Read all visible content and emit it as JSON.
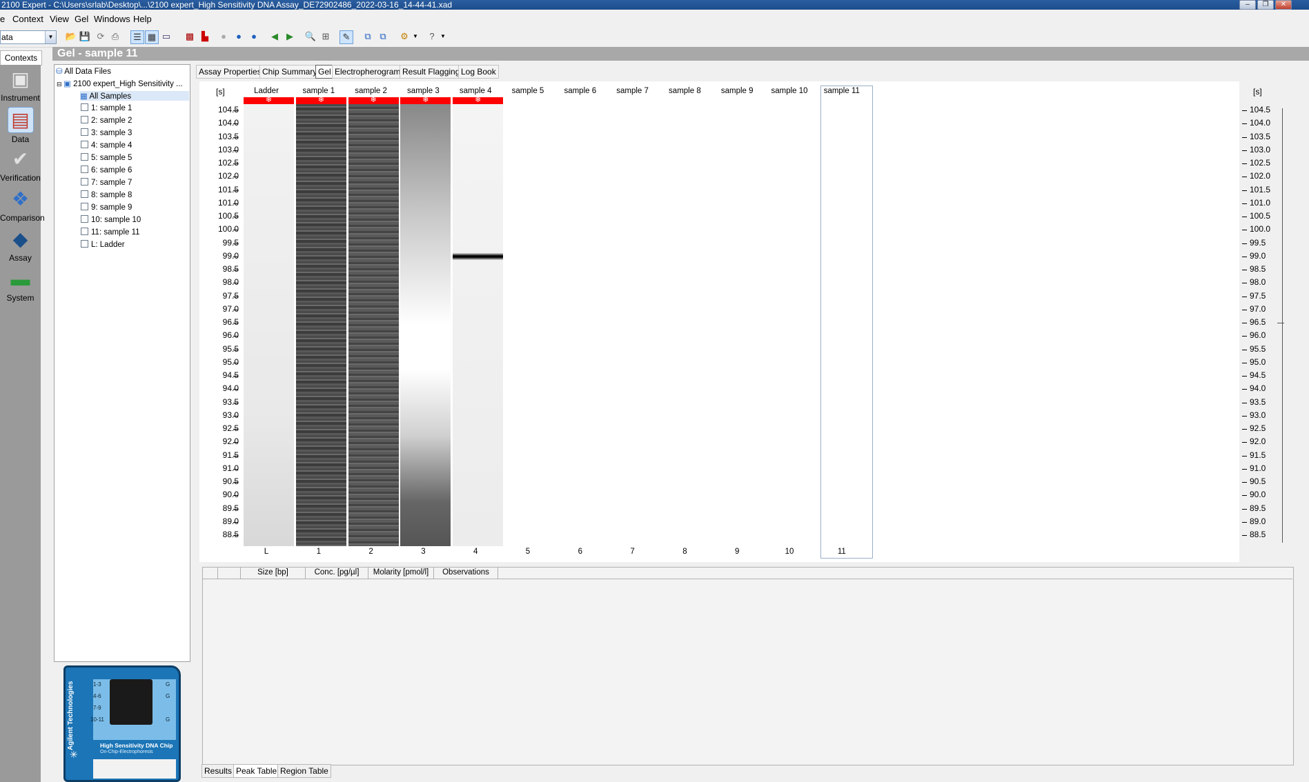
{
  "window": {
    "title": "2100 Expert - C:\\Users\\srlab\\Desktop\\...\\2100 expert_High Sensitivity DNA Assay_DE72902486_2022-03-16_14-44-41.xad",
    "minimize": "–",
    "restore": "❐",
    "close": "✕"
  },
  "menu": [
    "e",
    "Context",
    "View",
    "Gel",
    "Windows",
    "Help"
  ],
  "context_combo": "ata",
  "contexts_header": "Contexts",
  "contexts": [
    {
      "label": "Instrument",
      "icon": "instrument-icon"
    },
    {
      "label": "Data",
      "icon": "data-icon",
      "selected": true
    },
    {
      "label": "Verification",
      "icon": "verification-icon"
    },
    {
      "label": "Comparison",
      "icon": "comparison-icon"
    },
    {
      "label": "Assay",
      "icon": "assay-icon"
    },
    {
      "label": "System",
      "icon": "system-icon"
    }
  ],
  "header_title": "Gel - sample 11",
  "tree": {
    "root": "All Data Files",
    "file": "2100 expert_High Sensitivity ...",
    "all": "All Samples",
    "items": [
      "1: sample 1",
      "2: sample 2",
      "3: sample 3",
      "4: sample 4",
      "5: sample 5",
      "6: sample 6",
      "7: sample 7",
      "8: sample 8",
      "9: sample 9",
      "10: sample 10",
      "11: sample 11",
      "L: Ladder"
    ]
  },
  "chip": {
    "brand": "Agilent Technologies",
    "name": "High Sensitivity DNA Chip",
    "sub": "On-Chip-Electrophoresis",
    "rows": [
      "1-3",
      "4-6",
      "7-9",
      "10-11"
    ],
    "g": "G"
  },
  "tabs": [
    "Assay Properties",
    "Chip Summary",
    "Gel",
    "Electropherogram",
    "Result Flagging",
    "Log Book"
  ],
  "active_tab": "Gel",
  "gel": {
    "unit": "[s]",
    "lanes": [
      {
        "name": "Ladder",
        "num": "L"
      },
      {
        "name": "sample 1",
        "num": "1"
      },
      {
        "name": "sample 2",
        "num": "2"
      },
      {
        "name": "sample 3",
        "num": "3"
      },
      {
        "name": "sample 4",
        "num": "4"
      },
      {
        "name": "sample 5",
        "num": "5"
      },
      {
        "name": "sample 6",
        "num": "6"
      },
      {
        "name": "sample 7",
        "num": "7"
      },
      {
        "name": "sample 8",
        "num": "8"
      },
      {
        "name": "sample 9",
        "num": "9"
      },
      {
        "name": "sample 10",
        "num": "10"
      },
      {
        "name": "sample 11",
        "num": "11"
      }
    ],
    "ticks": [
      "104.5",
      "104.0",
      "103.5",
      "103.0",
      "102.5",
      "102.0",
      "101.5",
      "101.0",
      "100.5",
      "100.0",
      "99.5",
      "99.0",
      "98.5",
      "98.0",
      "97.5",
      "97.0",
      "96.5",
      "96.0",
      "95.5",
      "95.0",
      "94.5",
      "94.0",
      "93.5",
      "93.0",
      "92.5",
      "92.0",
      "91.5",
      "91.0",
      "90.5",
      "90.0",
      "89.5",
      "89.0",
      "88.5"
    ],
    "band_lane4_value": "99.0",
    "marker": "❄"
  },
  "results": {
    "columns": [
      "",
      "",
      "Size [bp]",
      "Conc. [pg/µl]",
      "Molarity [pmol/l]",
      "Observations"
    ]
  },
  "bottom_tabs": [
    "Results",
    "Peak Table",
    "Region Table"
  ],
  "active_bottom_tab": "Peak Table"
}
